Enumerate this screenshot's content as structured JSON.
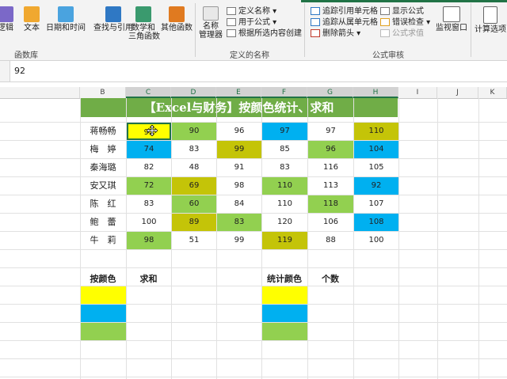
{
  "ribbon": {
    "buttons_left": [
      {
        "label": "逻辑",
        "icon": "question-icon",
        "color": "#7b68c8"
      },
      {
        "label": "文本",
        "icon": "text-icon",
        "color": "#f0a830"
      },
      {
        "label": "日期和时间",
        "icon": "clock-icon",
        "color": "#4aa3df"
      },
      {
        "label": "查找与引用",
        "icon": "search-icon",
        "color": "#2f78c4"
      },
      {
        "label": "数学和\n三角函数",
        "icon": "theta-icon",
        "color": "#3a9a6e"
      },
      {
        "label": "其他函数",
        "icon": "more-functions-icon",
        "color": "#e07a20"
      }
    ],
    "group_function_library": "函数库",
    "name_manager": "名称\n管理器",
    "defined_names": [
      "定义名称 ▾",
      "用于公式 ▾",
      "根据所选内容创建"
    ],
    "group_defined_names": "定义的名称",
    "audit_col1": [
      "追踪引用单元格",
      "追踪从属单元格",
      "删除箭头 ▾"
    ],
    "audit_col2": [
      "显示公式",
      "错误检查 ▾",
      "公式求值"
    ],
    "group_formula_audit": "公式审核",
    "watch_window": "监视窗口",
    "calc_options": "计算选项"
  },
  "formula_bar": {
    "value": "92"
  },
  "columns": [
    "B",
    "C",
    "D",
    "E",
    "F",
    "G",
    "H",
    "I",
    "J",
    "K"
  ],
  "sheet": {
    "title": "【Excel与财务】按颜色统计、求和",
    "colors": {
      "yellow": "#ffff00",
      "blue": "#00b0f0",
      "green": "#92d050",
      "olive": "#c4c408",
      "title_green": "#70ad47"
    },
    "rows": [
      {
        "name": "蒋畅畅",
        "cells": [
          {
            "v": "92",
            "c": "yellow"
          },
          {
            "v": "90",
            "c": "green"
          },
          {
            "v": "96",
            "c": ""
          },
          {
            "v": "97",
            "c": "blue"
          },
          {
            "v": "97",
            "c": ""
          },
          {
            "v": "110",
            "c": "olive"
          }
        ]
      },
      {
        "name": "梅　婷",
        "cells": [
          {
            "v": "74",
            "c": "blue"
          },
          {
            "v": "83",
            "c": ""
          },
          {
            "v": "99",
            "c": "olive"
          },
          {
            "v": "85",
            "c": ""
          },
          {
            "v": "96",
            "c": "green"
          },
          {
            "v": "104",
            "c": "blue"
          }
        ]
      },
      {
        "name": "秦海璐",
        "cells": [
          {
            "v": "82",
            "c": ""
          },
          {
            "v": "48",
            "c": ""
          },
          {
            "v": "91",
            "c": ""
          },
          {
            "v": "83",
            "c": ""
          },
          {
            "v": "116",
            "c": ""
          },
          {
            "v": "105",
            "c": ""
          }
        ]
      },
      {
        "name": "安又琪",
        "cells": [
          {
            "v": "72",
            "c": "green"
          },
          {
            "v": "69",
            "c": "olive"
          },
          {
            "v": "98",
            "c": ""
          },
          {
            "v": "110",
            "c": "green"
          },
          {
            "v": "113",
            "c": ""
          },
          {
            "v": "92",
            "c": "blue"
          }
        ]
      },
      {
        "name": "陈　红",
        "cells": [
          {
            "v": "83",
            "c": ""
          },
          {
            "v": "60",
            "c": "green"
          },
          {
            "v": "84",
            "c": ""
          },
          {
            "v": "110",
            "c": ""
          },
          {
            "v": "118",
            "c": "green"
          },
          {
            "v": "107",
            "c": ""
          }
        ]
      },
      {
        "name": "鲍　蕾",
        "cells": [
          {
            "v": "100",
            "c": ""
          },
          {
            "v": "89",
            "c": "olive"
          },
          {
            "v": "83",
            "c": "green"
          },
          {
            "v": "120",
            "c": ""
          },
          {
            "v": "106",
            "c": ""
          },
          {
            "v": "108",
            "c": "blue"
          }
        ]
      },
      {
        "name": "牛　莉",
        "cells": [
          {
            "v": "98",
            "c": "green"
          },
          {
            "v": "51",
            "c": ""
          },
          {
            "v": "99",
            "c": ""
          },
          {
            "v": "119",
            "c": "olive"
          },
          {
            "v": "88",
            "c": ""
          },
          {
            "v": "100",
            "c": ""
          }
        ]
      }
    ],
    "sum_header": {
      "color_label": "按颜色",
      "sum_label": "求和"
    },
    "count_header": {
      "color_label": "统计颜色",
      "count_label": "个数"
    },
    "swatches": [
      "yellow",
      "blue",
      "green"
    ]
  }
}
